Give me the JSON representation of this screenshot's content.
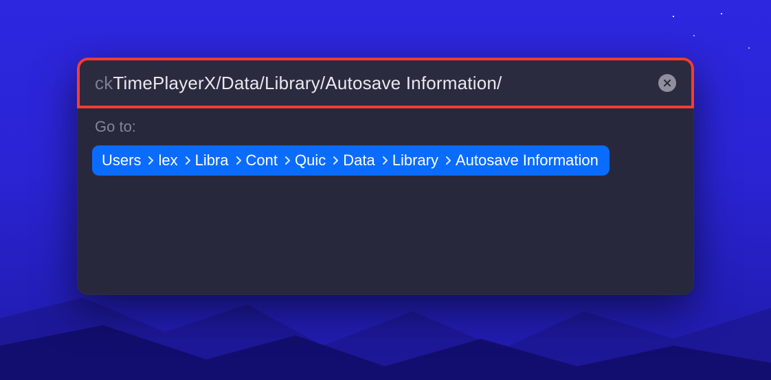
{
  "input": {
    "visible_prefix_dimmed": "ck",
    "visible_text": "TimePlayerX/Data/Library/Autosave Information/"
  },
  "section_label": "Go to:",
  "breadcrumb": {
    "items": [
      {
        "label": "Users"
      },
      {
        "label": "lex"
      },
      {
        "label": "Libra"
      },
      {
        "label": "Cont"
      },
      {
        "label": "Quic"
      },
      {
        "label": "Data"
      },
      {
        "label": "Library"
      },
      {
        "label": "Autosave Information"
      }
    ]
  },
  "colors": {
    "panel_bg": "#28283c",
    "highlight_border": "#ff3b2f",
    "selection_bg": "#0a6cff"
  }
}
